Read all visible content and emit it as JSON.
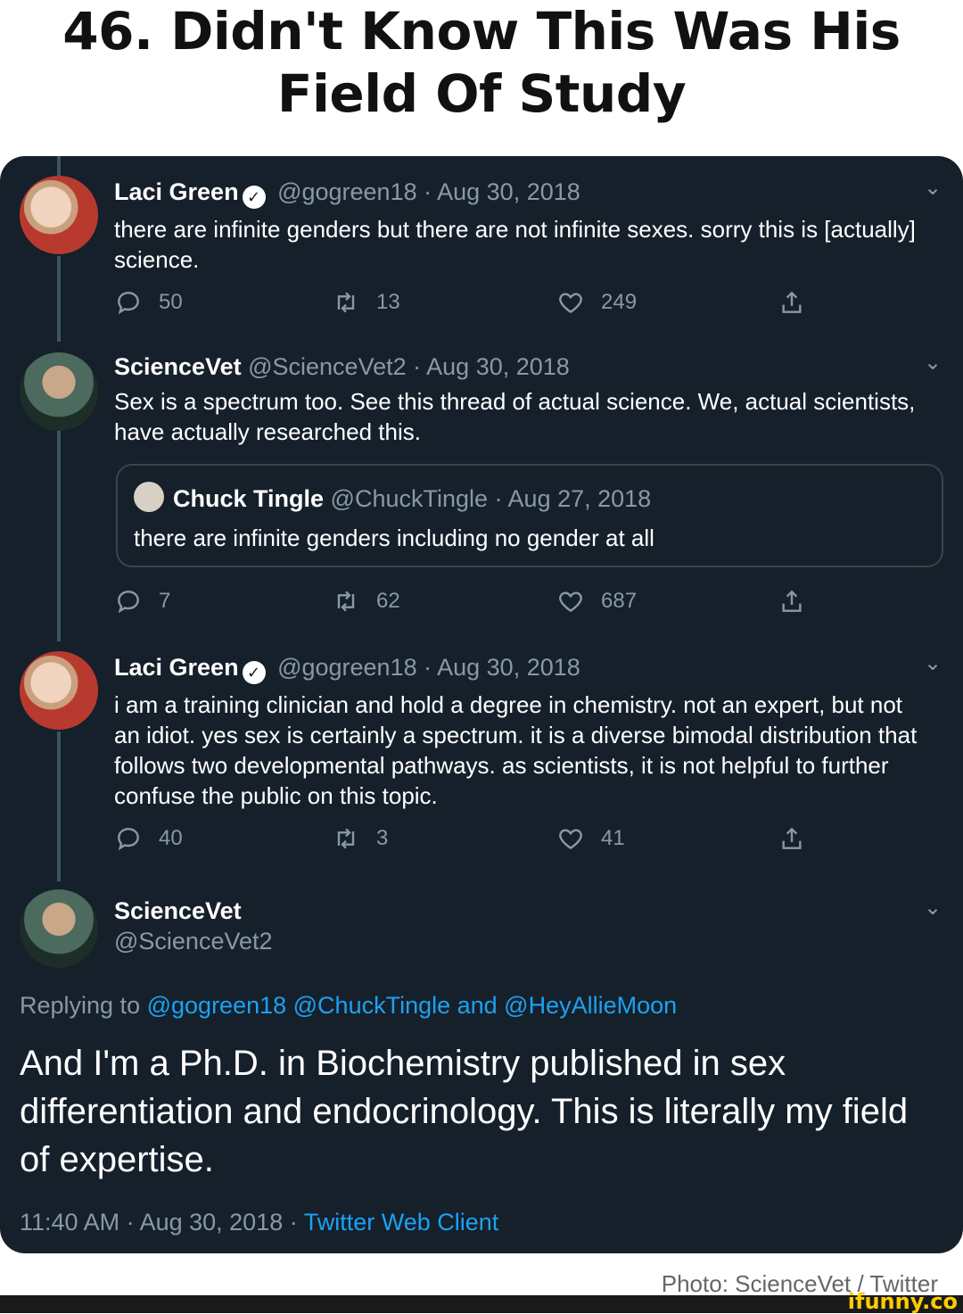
{
  "headline": "46. Didn't Know This Was His Field Of Study",
  "tweets": [
    {
      "name": "Laci Green",
      "verified": true,
      "handle": "@gogreen18",
      "date": "· Aug 30, 2018",
      "text": "there are infinite genders but there are not infinite sexes. sorry this is [actually] science.",
      "replies": "50",
      "retweets": "13",
      "likes": "249"
    },
    {
      "name": "ScienceVet",
      "handle": "@ScienceVet2",
      "date": "· Aug 30, 2018",
      "text": "Sex is a spectrum too. See this thread of actual science. We, actual scientists, have actually researched this.",
      "quote": {
        "name": "Chuck Tingle",
        "handle": "@ChuckTingle",
        "date": "· Aug 27, 2018",
        "text": "there are infinite genders including no gender at all"
      },
      "replies": "7",
      "retweets": "62",
      "likes": "687"
    },
    {
      "name": "Laci Green",
      "verified": true,
      "handle": "@gogreen18",
      "date": "· Aug 30, 2018",
      "text": "i am a training clinician and hold a degree in chemistry. not an expert, but not an idiot. yes sex is certainly a spectrum. it is a diverse bimodal distribution that follows two developmental pathways. as scientists, it is not helpful to further confuse the public on this topic.",
      "replies": "40",
      "retweets": "3",
      "likes": "41"
    }
  ],
  "main_tweet": {
    "name": "ScienceVet",
    "handle": "@ScienceVet2",
    "replying_prefix": "Replying to",
    "replying_to": "@gogreen18 @ChuckTingle and @HeyAllieMoon",
    "text": "And I'm a Ph.D. in Biochemistry published in sex differentiation and endocrinology. This is literally my field of expertise.",
    "time": "11:40 AM · Aug 30, 2018 ·",
    "client": "Twitter Web Client"
  },
  "caption": "Photo: ScienceVet / Twitter",
  "watermark": "ifunny.co",
  "colors": {
    "background": "#15202b",
    "muted": "#8899a6",
    "link": "#1da1f2",
    "thread_line": "#3d5466"
  }
}
